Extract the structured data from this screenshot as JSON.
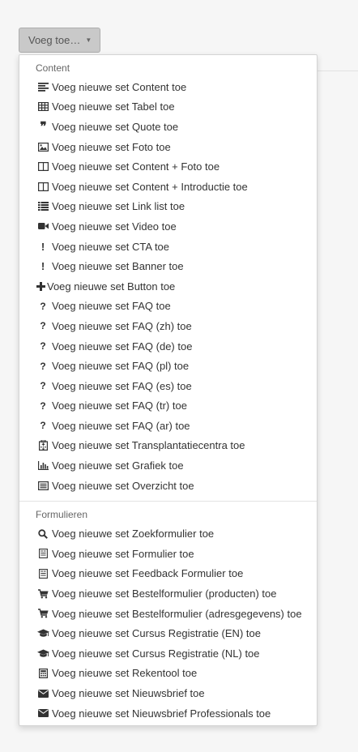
{
  "toggle": {
    "label": "Voeg toe…"
  },
  "sections": [
    {
      "header": "Content",
      "items": [
        {
          "label": "Voeg nieuwe set Content toe",
          "icon": "align-left-icon"
        },
        {
          "label": "Voeg nieuwe set Tabel toe",
          "icon": "table-icon"
        },
        {
          "label": "Voeg nieuwe set Quote toe",
          "icon": "quote-icon"
        },
        {
          "label": "Voeg nieuwe set Foto toe",
          "icon": "image-icon"
        },
        {
          "label": "Voeg nieuwe set Content + Foto toe",
          "icon": "columns-icon"
        },
        {
          "label": "Voeg nieuwe set Content + Introductie toe",
          "icon": "columns-icon"
        },
        {
          "label": "Voeg nieuwe set Link list toe",
          "icon": "list-icon"
        },
        {
          "label": "Voeg nieuwe set Video toe",
          "icon": "video-camera-icon"
        },
        {
          "label": "Voeg nieuwe set CTA toe",
          "icon": "exclamation-icon"
        },
        {
          "label": "Voeg nieuwe set Banner toe",
          "icon": "exclamation-icon"
        },
        {
          "label": "Voeg nieuwe set Button toe",
          "icon": "plus-icon"
        },
        {
          "label": "Voeg nieuwe set FAQ toe",
          "icon": "question-icon"
        },
        {
          "label": "Voeg nieuwe set FAQ (zh) toe",
          "icon": "question-icon"
        },
        {
          "label": "Voeg nieuwe set FAQ (de) toe",
          "icon": "question-icon"
        },
        {
          "label": "Voeg nieuwe set FAQ (pl) toe",
          "icon": "question-icon"
        },
        {
          "label": "Voeg nieuwe set FAQ (es) toe",
          "icon": "question-icon"
        },
        {
          "label": "Voeg nieuwe set FAQ (tr) toe",
          "icon": "question-icon"
        },
        {
          "label": "Voeg nieuwe set FAQ (ar) toe",
          "icon": "question-icon"
        },
        {
          "label": "Voeg nieuwe set Transplantatiecentra toe",
          "icon": "hospital-icon"
        },
        {
          "label": "Voeg nieuwe set Grafiek toe",
          "icon": "bar-chart-icon"
        },
        {
          "label": "Voeg nieuwe set Overzicht toe",
          "icon": "list-alt-icon"
        }
      ]
    },
    {
      "header": "Formulieren",
      "items": [
        {
          "label": "Voeg nieuwe set Zoekformulier toe",
          "icon": "search-icon"
        },
        {
          "label": "Voeg nieuwe set Formulier toe",
          "icon": "form-icon"
        },
        {
          "label": "Voeg nieuwe set Feedback Formulier toe",
          "icon": "form-icon"
        },
        {
          "label": "Voeg nieuwe set Bestelformulier (producten) toe",
          "icon": "shopping-cart-icon"
        },
        {
          "label": "Voeg nieuwe set Bestelformulier (adresgegevens) toe",
          "icon": "shopping-cart-icon"
        },
        {
          "label": "Voeg nieuwe set Cursus Registratie (EN) toe",
          "icon": "graduation-cap-icon"
        },
        {
          "label": "Voeg nieuwe set Cursus Registratie (NL) toe",
          "icon": "graduation-cap-icon"
        },
        {
          "label": "Voeg nieuwe set Rekentool toe",
          "icon": "calculator-icon"
        },
        {
          "label": "Voeg nieuwe set Nieuwsbrief toe",
          "icon": "envelope-icon"
        },
        {
          "label": "Voeg nieuwe set Nieuwsbrief Professionals toe",
          "icon": "envelope-icon"
        }
      ]
    }
  ]
}
